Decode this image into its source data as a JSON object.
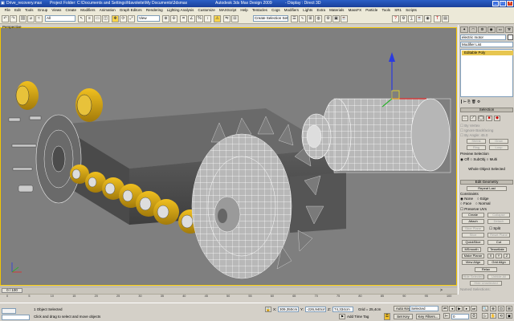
{
  "window": {
    "file_title": "Drive_recovery.max",
    "project_folder": "Project Folder: C:\\Documents and Settings\\fdavoleite\\My Documents\\3dsmax",
    "app_title": "Autodesk 3ds Max Design 2009",
    "display_mode": "- Display : Direct 3D"
  },
  "menu": [
    "File",
    "Edit",
    "Tools",
    "Group",
    "Views",
    "Create",
    "Modifiers",
    "Animation",
    "Graph Editors",
    "Rendering",
    "Lighting Analysis",
    "Customize",
    "MAXScript",
    "Help",
    "Tentacles",
    "Cogs",
    "Modifiers",
    "Lights",
    "Extra",
    "Materials",
    "MassFX",
    "Particle",
    "Tools",
    "SR1",
    "Scripts"
  ],
  "toolbar": {
    "undo": "↶",
    "redo": "↷",
    "filter": "All",
    "ref_coord": "View",
    "named_selection": "Create Selection Set"
  },
  "viewport": {
    "label": "Perspective"
  },
  "command_panel": {
    "tabs": [
      "✦",
      "◠",
      "⚙",
      "◉",
      "▭",
      "⚒"
    ],
    "object_name": "electric motor",
    "modifier_list": "Modifier List",
    "stack_item": "Editable Poly",
    "selection_header": "Selection",
    "by_vertex": "By Vertex",
    "ignore_backfacing": "Ignore Backfacing",
    "by_angle": "By Angle:",
    "by_angle_value": "45.0",
    "shrink": "Shrink",
    "grow": "Grow",
    "ring": "Ring",
    "loop": "Loop",
    "preview_selection": "Preview Selection",
    "preview_opts": [
      "Off",
      "SubObj",
      "Multi"
    ],
    "whole_selected": "Whole Object Selected",
    "edit_geometry": "Edit Geometry",
    "repeat_last": "Repeat Last",
    "constraints": "Constraints",
    "c_none": "None",
    "c_edge": "Edge",
    "c_face": "Face",
    "c_normal": "Normal",
    "preserve_uvs": "Preserve UVs",
    "create": "Create",
    "collapse": "Collapse",
    "attach": "Attach",
    "detach": "Detach",
    "slice_plane": "Slice Plane",
    "split": "Split",
    "slice": "Slice",
    "reset_plane": "Reset Plane",
    "quickslice": "QuickSlice",
    "cut": "Cut",
    "msmooth": "MSmooth",
    "tessellate": "Tessellate",
    "make_planar": "Make Planar",
    "x": "X",
    "y": "Y",
    "z": "Z",
    "view_align": "View Align",
    "grid_align": "Grid Align",
    "relax": "Relax",
    "hide_selected": "Hide Selected",
    "unhide_all": "Unhide All",
    "hide_unselected": "Hide Unselected",
    "named_selections": "Named Selections:"
  },
  "timeline": {
    "slider": "0 / 100",
    "ticks": [
      "0",
      "5",
      "10",
      "15",
      "20",
      "25",
      "30",
      "35",
      "40",
      "45",
      "50",
      "55",
      "60",
      "65",
      "70",
      "75",
      "80",
      "85",
      "90",
      "95",
      "100"
    ]
  },
  "status": {
    "selected_count": "1 Object Selected",
    "prompt": "Click and drag to select and move objects",
    "x_label": "X:",
    "x_value": "309,350cm",
    "y_label": "Y:",
    "y_value": "-226,940cm",
    "z_label": "Z:",
    "z_value": "74,334cm",
    "grid": "Grid = 25,4cm",
    "add_time_tag": "Add Time Tag",
    "auto_key": "Auto Key",
    "set_key": "Set Key",
    "selected_dropdown": "Selected",
    "key_filters": "Key Filters...",
    "frame": "0"
  }
}
